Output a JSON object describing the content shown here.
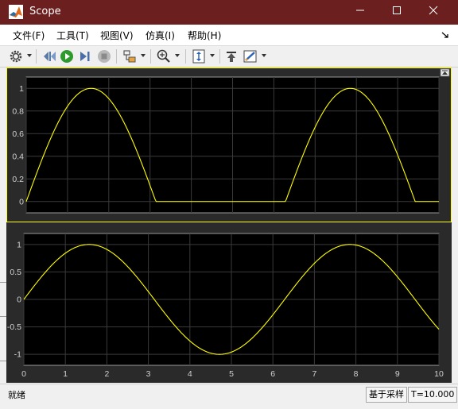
{
  "window": {
    "title": "Scope"
  },
  "menu": {
    "items": [
      "文件(F)",
      "工具(T)",
      "视图(V)",
      "仿真(I)",
      "帮助(H)"
    ]
  },
  "toolbar": {
    "icons": [
      "gear-icon",
      "step-back-icon",
      "run-icon",
      "step-forward-icon",
      "stop-icon",
      "highlight-block-icon",
      "zoom-icon",
      "autoscale-icon",
      "restore-icon",
      "style-icon"
    ]
  },
  "status": {
    "left": "就绪",
    "mode": "基于采样",
    "time": "T=10.000"
  },
  "colors": {
    "trace": "#ffff00",
    "plot_bg": "#000000",
    "frame_bg": "#2a2a2a",
    "grid": "#3c3c3c",
    "titlebar": "#6b1f1f"
  },
  "chart_data": [
    {
      "type": "line",
      "title": "",
      "xlabel": "",
      "ylabel": "",
      "xlim": [
        0,
        10
      ],
      "ylim": [
        -0.1,
        1.1
      ],
      "yticks": [
        "1",
        "0.8",
        "0.6",
        "0.4",
        "0.2",
        "0"
      ],
      "ytick_values": [
        1,
        0.8,
        0.6,
        0.4,
        0.2,
        0
      ],
      "xticks": [
        0,
        1,
        2,
        3,
        4,
        5,
        6,
        7,
        8,
        9,
        10
      ],
      "show_xtick_labels": false,
      "grid": true,
      "selected": true,
      "series": [
        {
          "function": "max(0, sin(t))",
          "x_range": [
            0,
            10
          ]
        }
      ]
    },
    {
      "type": "line",
      "title": "",
      "xlabel": "",
      "ylabel": "",
      "xlim": [
        0,
        10
      ],
      "ylim": [
        -1.2,
        1.2
      ],
      "yticks": [
        "1",
        "0.5",
        "0",
        "-0.5",
        "-1"
      ],
      "ytick_values": [
        1,
        0.5,
        0,
        -0.5,
        -1
      ],
      "xticks": [
        0,
        1,
        2,
        3,
        4,
        5,
        6,
        7,
        8,
        9,
        10
      ],
      "xtick_labels": [
        "0",
        "1",
        "2",
        "3",
        "4",
        "5",
        "6",
        "7",
        "8",
        "9",
        "10"
      ],
      "show_xtick_labels": true,
      "grid": true,
      "selected": false,
      "series": [
        {
          "function": "sin(t)",
          "x_range": [
            0,
            10
          ]
        }
      ]
    }
  ]
}
